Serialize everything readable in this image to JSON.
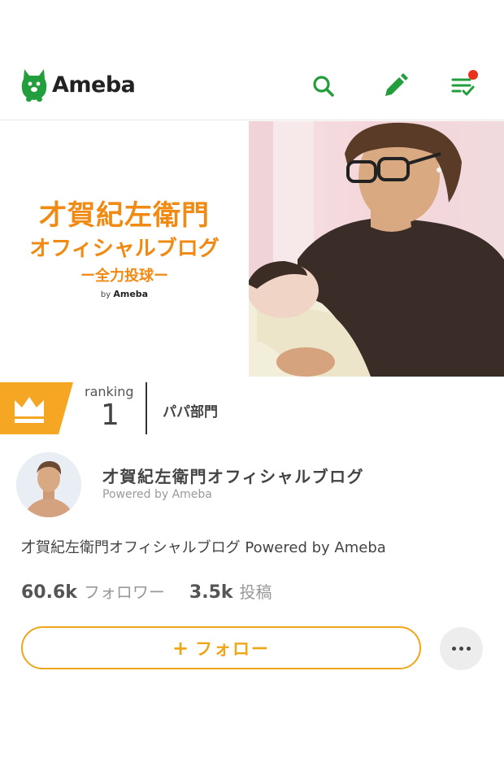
{
  "header": {
    "logo_text": "Ameba",
    "icons": [
      "mascot-icon",
      "search-icon",
      "edit-icon",
      "reader-icon"
    ],
    "has_notification": true,
    "brand_color": "#239e3c"
  },
  "banner": {
    "title": "才賀紀左衛門",
    "subtitle": "オフィシャルブログ",
    "tagline": "ー全力投球ー",
    "by_label": "by",
    "by_brand": "Ameba",
    "accent_color": "#f08a12"
  },
  "ranking": {
    "label": "ranking",
    "rank": "1",
    "category": "パパ部門"
  },
  "profile": {
    "blog_name": "才賀紀左衛門オフィシャルブログ",
    "powered_by": "Powered by Ameba",
    "description": "才賀紀左衛門オフィシャルブログ Powered by Ameba"
  },
  "stats": {
    "followers_count": "60.6k",
    "followers_label": "フォロワー",
    "posts_count": "3.5k",
    "posts_label": "投稿"
  },
  "actions": {
    "follow_plus": "+",
    "follow_label": "フォロー",
    "follow_color": "#f0a619",
    "more_icon": "more-icon"
  }
}
